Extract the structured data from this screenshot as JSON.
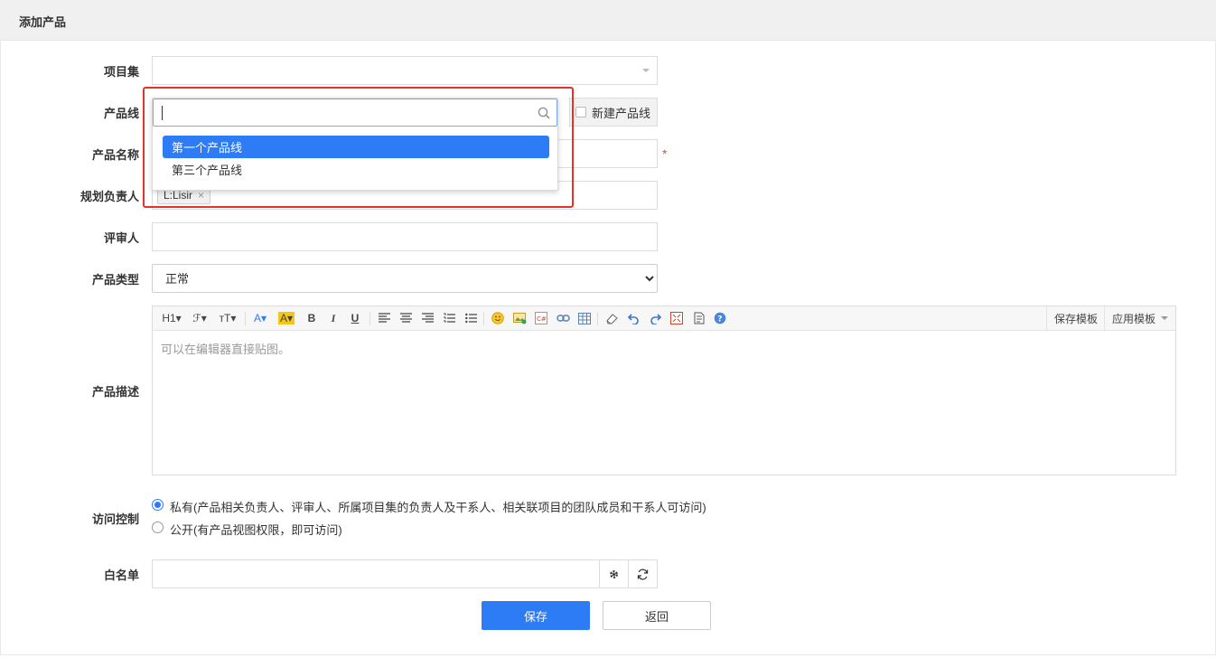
{
  "header": {
    "title": "添加产品"
  },
  "form": {
    "project_set": {
      "label": "项目集",
      "value": ""
    },
    "product_line": {
      "label": "产品线",
      "new_line_label": "新建产品线"
    },
    "product_name": {
      "label": "产品名称",
      "required_mark": "*"
    },
    "planner": {
      "label": "规划负责人",
      "chips": [
        "L:Lisir"
      ],
      "chip_remove": "×"
    },
    "reviewer": {
      "label": "评审人",
      "value": ""
    },
    "product_type": {
      "label": "产品类型",
      "selected": "正常",
      "options": [
        "正常"
      ]
    },
    "description": {
      "label": "产品描述",
      "placeholder": "可以在编辑器直接贴图。",
      "toolbar": {
        "h1": "H1▾",
        "font_family": "ℱ▾",
        "font_size": "ᴛT▾",
        "font_color": "A▾",
        "bg_color": "A▾",
        "bold": "B",
        "italic": "I",
        "underline": "U",
        "save_template": "保存模板",
        "apply_template": "应用模板"
      }
    },
    "access": {
      "label": "访问控制",
      "options": [
        {
          "text": "私有(产品相关负责人、评审人、所属项目集的负责人及干系人、相关联项目的团队成员和干系人可访问)",
          "checked": true
        },
        {
          "text": "公开(有产品视图权限，即可访问)",
          "checked": false
        }
      ]
    },
    "whitelist": {
      "label": "白名单",
      "value": ""
    },
    "buttons": {
      "save": "保存",
      "back": "返回"
    }
  },
  "dropdown": {
    "search_value": "",
    "options": [
      {
        "label": "第一个产品线",
        "active": true
      },
      {
        "label": "第三个产品线",
        "active": false
      }
    ]
  },
  "colors": {
    "primary": "#2e7bf6",
    "highlight": "#e5322d",
    "required": "#e74c3c"
  }
}
